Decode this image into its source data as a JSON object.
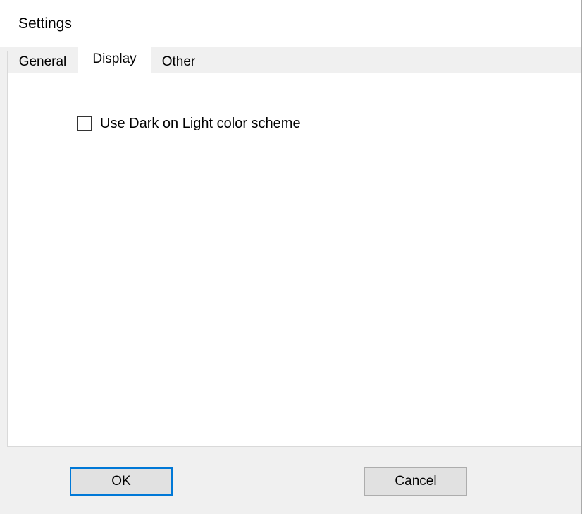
{
  "window": {
    "title": "Settings"
  },
  "tabs": [
    {
      "label": "General",
      "selected": false
    },
    {
      "label": "Display",
      "selected": true
    },
    {
      "label": "Other",
      "selected": false
    }
  ],
  "display_panel": {
    "dark_on_light": {
      "label": "Use Dark on Light color scheme",
      "checked": false
    }
  },
  "buttons": {
    "ok_label": "OK",
    "cancel_label": "Cancel"
  },
  "colors": {
    "focus_border": "#0078d7",
    "panel_bg": "#ffffff",
    "dialog_bg": "#f0f0f0"
  }
}
